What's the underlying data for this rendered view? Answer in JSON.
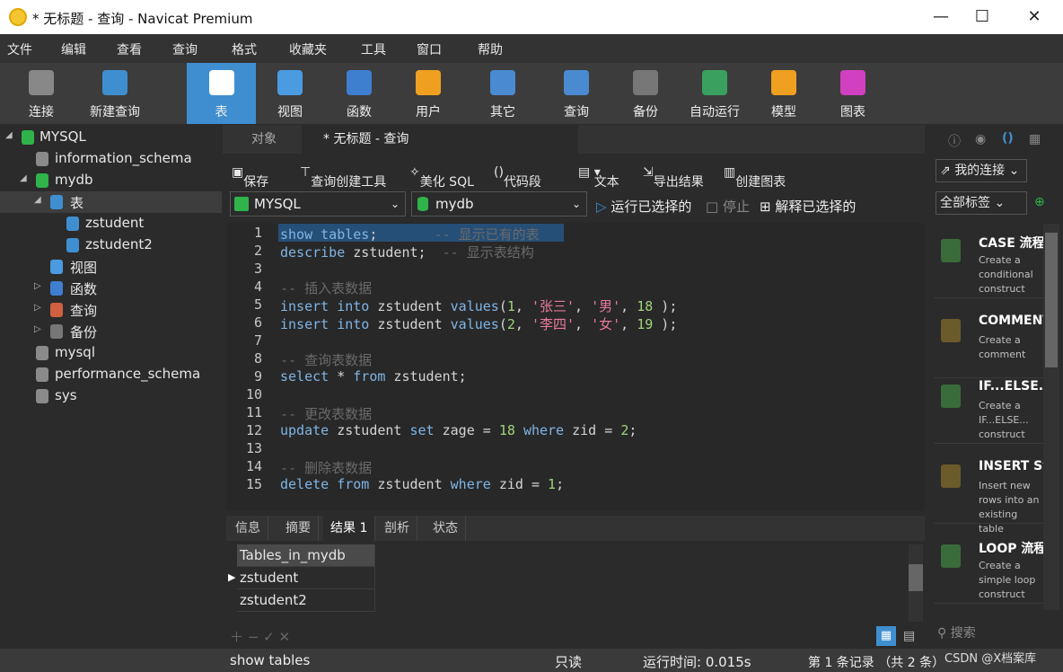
{
  "window": {
    "title": "* 无标题 - 查询 - Navicat Premium",
    "min": "—",
    "max": "☐",
    "close": "✕"
  },
  "menu": [
    "文件",
    "编辑",
    "查看",
    "查询",
    "格式",
    "收藏夹",
    "工具",
    "窗口",
    "帮助"
  ],
  "toolbar": [
    "连接",
    "新建查询",
    "表",
    "视图",
    "函数",
    "用户",
    "其它",
    "查询",
    "备份",
    "自动运行",
    "模型",
    "图表"
  ],
  "tree": {
    "items": [
      "MYSQL",
      "information_schema",
      "mydb",
      "表",
      "zstudent",
      "zstudent2",
      "视图",
      "函数",
      "查询",
      "备份",
      "mysql",
      "performance_schema",
      "sys"
    ]
  },
  "tabs": {
    "objects": "对象",
    "query": "* 无标题 - 查询"
  },
  "qtool": {
    "save": "保存",
    "builder": "查询创建工具",
    "beautify": "美化 SQL",
    "snippet": "代码段",
    "text": "文本",
    "export": "导出结果",
    "chart": "创建图表",
    "run": "运行已选择的",
    "stop": "停止",
    "explain": "解释已选择的"
  },
  "selects": {
    "conn": "MYSQL",
    "db": "mydb"
  },
  "editor": {
    "lines": [
      "1",
      "2",
      "3",
      "4",
      "5",
      "6",
      "7",
      "8",
      "9",
      "10",
      "11",
      "12",
      "13",
      "14",
      "15"
    ]
  },
  "result_tabs": [
    "信息",
    "摘要",
    "结果 1",
    "剖析",
    "状态"
  ],
  "grid": {
    "header": "Tables_in_mydb",
    "rows": [
      "zstudent",
      "zstudent2"
    ]
  },
  "status": {
    "sql": "show tables",
    "readonly": "只读",
    "time": "运行时间: 0.015s",
    "record": "第 1 条记录 （共 2 条）",
    "watermark": "CSDN @X档案库"
  },
  "right": {
    "conn": "我的连接",
    "tags": "全部标签",
    "search": "搜索",
    "snippets": [
      {
        "title": "CASE 流程控",
        "desc": "Create a conditional construct"
      },
      {
        "title": "COMMENT",
        "desc": "Create a comment"
      },
      {
        "title": "IF...ELSE...",
        "desc": "Create a IF...ELSE... construct"
      },
      {
        "title": "INSERT Sy",
        "desc": "Insert new rows into an existing table"
      },
      {
        "title": "LOOP 流程控",
        "desc": "Create a simple loop construct"
      }
    ]
  }
}
